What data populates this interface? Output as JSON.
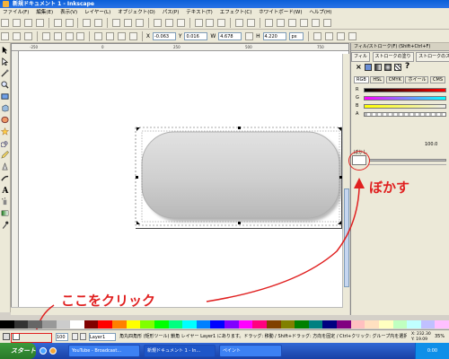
{
  "window": {
    "title": "新規ドキュメント 1 - Inkscape"
  },
  "menu": [
    "ファイル(F)",
    "編集(E)",
    "表示(V)",
    "レイヤー(L)",
    "オブジェクト(O)",
    "パス(P)",
    "テキスト(T)",
    "エフェクト(C)",
    "ホワイトボード(W)",
    "ヘルプ(H)"
  ],
  "toolbar2": {
    "x_label": "X",
    "x_value": "-0.063",
    "y_label": "Y",
    "y_value": "0.016",
    "w_label": "W",
    "w_value": "4.678",
    "h_label": "H",
    "h_value": "4.220",
    "unit": "px"
  },
  "ruler": {
    "ticks": [
      "-250",
      "0",
      "250",
      "500",
      "750"
    ]
  },
  "dialog": {
    "title": "フィル/ストローク(F) (Shift+Ctrl+F)",
    "tabs": [
      "フィル",
      "ストロークの塗り",
      "ストロークのスタイル"
    ],
    "question": "?",
    "mode_tabs": [
      "RGB",
      "HSL",
      "CMYK",
      "ホイール",
      "CMS"
    ],
    "channels": [
      "R",
      "G",
      "B",
      "A"
    ],
    "alpha_value": "100.0",
    "blur_label": "ぼかし"
  },
  "annotations": {
    "blur": "ぼかす",
    "click_here": "ここをクリック"
  },
  "statusbar": {
    "opacity_value": "100",
    "layer": "Layer1",
    "message": "角丸四角形 (矩形ツール) 鎖角 レイヤー Layer1 にあります。ドラッグ: 移動 / Shift+ドラッグ: 方向を固定 / Ctrl+クリック: グループ内を選択",
    "coords_x": "X: 232.30",
    "coords_y": "Y: 19.09",
    "zoom": "35%"
  },
  "taskbar": {
    "start": "スタート",
    "tasks": [
      "YouTube - Broadcast...",
      "新規ドキュメント 1 - In...",
      "ペイント"
    ],
    "clock": "0:00"
  },
  "colors": {
    "accent": "#e02020",
    "titlebar": "#0a5fd8",
    "selection": "#3c81f3"
  }
}
